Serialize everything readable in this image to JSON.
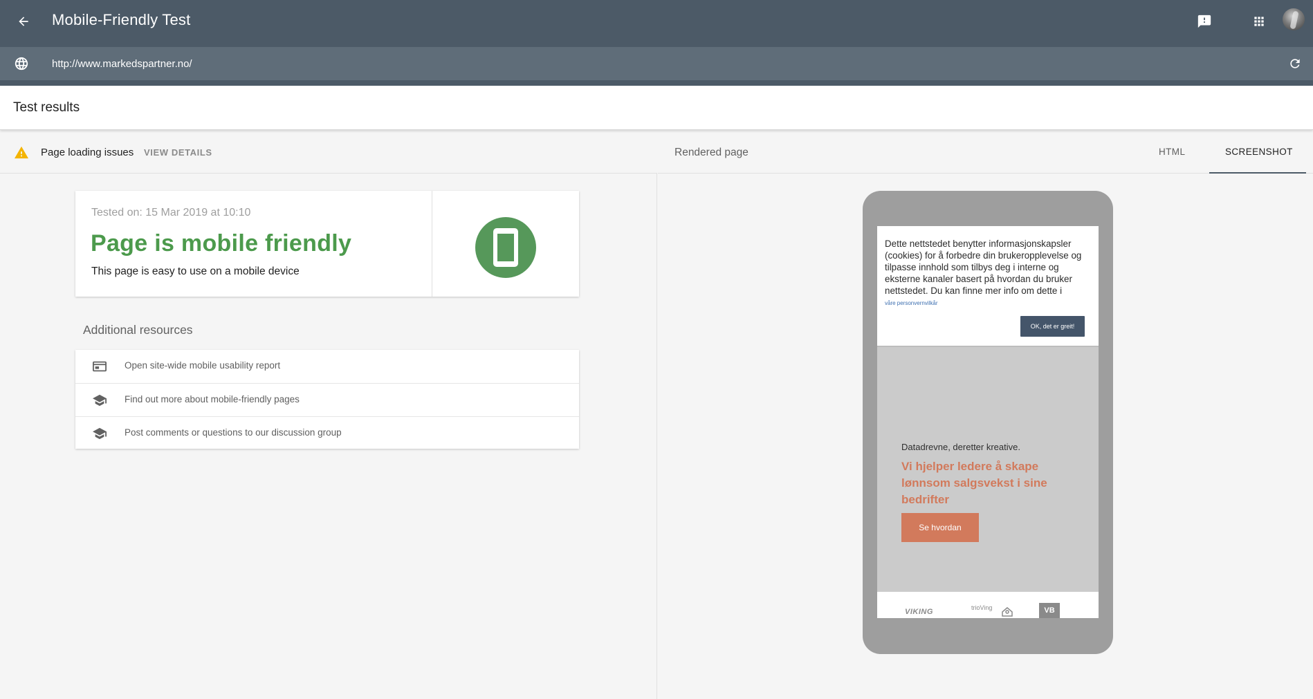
{
  "app": {
    "title": "Mobile-Friendly Test",
    "url_value": "http://www.markedspartner.no/"
  },
  "results": {
    "title": "Test results",
    "issues_text": "Page loading issues",
    "view_details_label": "VIEW DETAILS",
    "tested_on": "Tested on: 15 Mar 2019 at 10:10",
    "status_title": "Page is mobile friendly",
    "status_desc": "This page is easy to use on a mobile device",
    "status_color": "#4c9a4c"
  },
  "resources": {
    "title": "Additional resources",
    "items": [
      {
        "label": "Open site-wide mobile usability report",
        "icon": "report-icon"
      },
      {
        "label": "Find out more about mobile-friendly pages",
        "icon": "school-icon"
      },
      {
        "label": "Post comments or questions to our discussion group",
        "icon": "school-icon"
      }
    ]
  },
  "rendered": {
    "title": "Rendered page",
    "tabs": [
      {
        "label": "HTML",
        "selected": false
      },
      {
        "label": "SCREENSHOT",
        "selected": true
      }
    ]
  },
  "preview": {
    "cookie_text": "Dette nettstedet benytter informasjonskapsler (cookies) for å forbedre din brukeropplevelse og tilpasse innhold som tilbys deg i interne og eksterne kanaler basert på hvordan du bruker nettstedet. Du kan finne mer info om dette i",
    "cookie_link": "våre personvernvilkår",
    "ok_button": "OK, det er greit!",
    "tagline": "Datadrevne, deretter kreative.",
    "headline": "Vi hjelper ledere å skape lønnsom salgsvekst i sine bedrifter",
    "cta": "Se hvordan",
    "logos": [
      "VIKING",
      "trioVing",
      "VB"
    ],
    "accent_color": "#d27a5c"
  },
  "colors": {
    "appbar": "#4c5a67",
    "urlbar": "#5f6d79",
    "warning": "#f4b400"
  }
}
